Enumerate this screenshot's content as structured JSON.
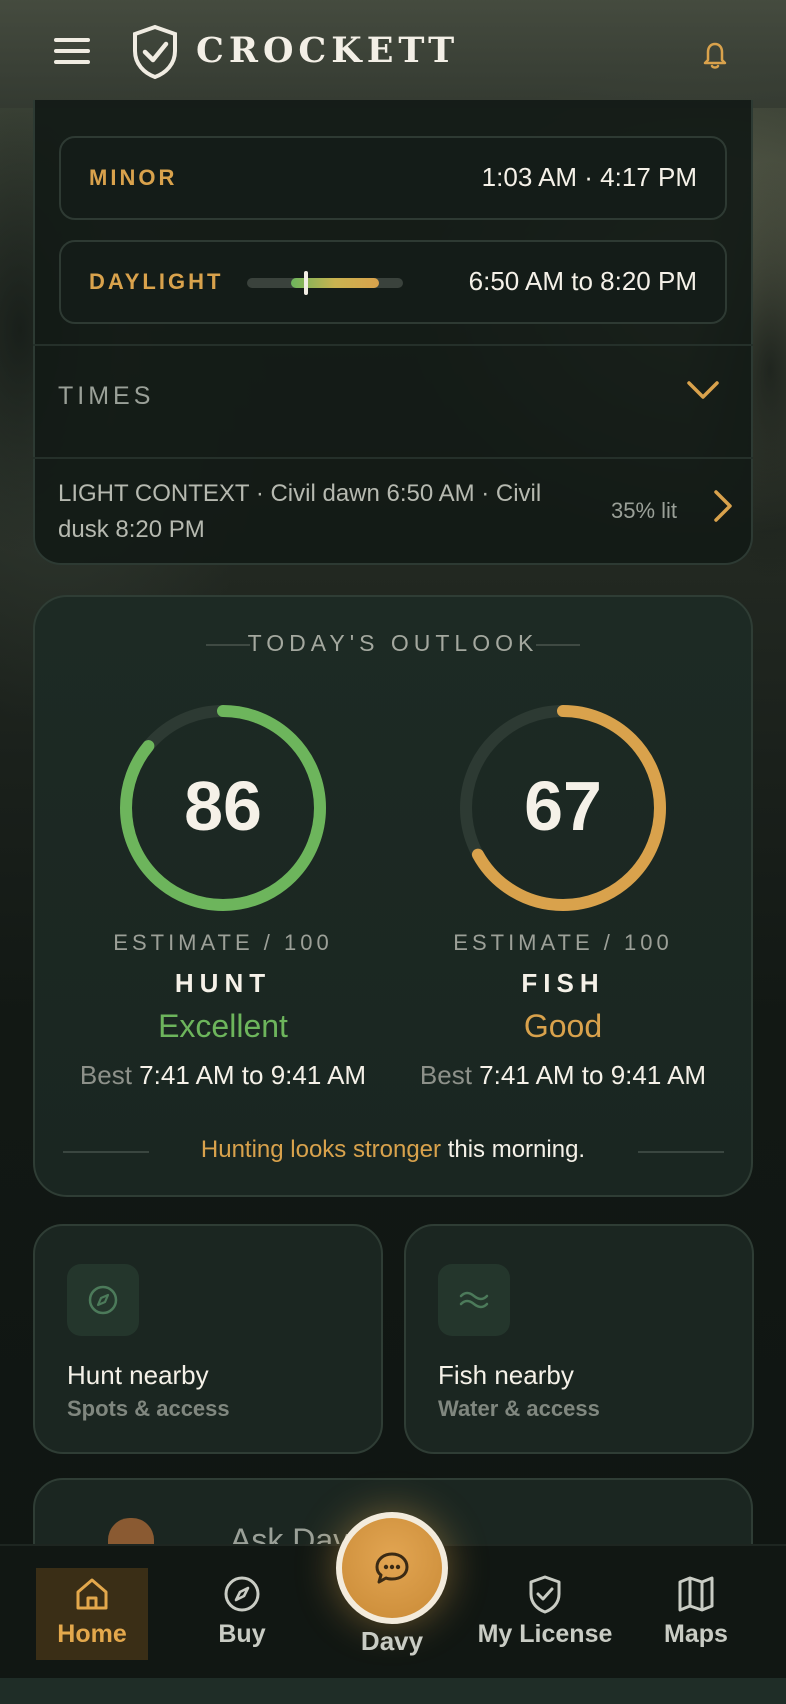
{
  "app": {
    "brand": "CROCKETT"
  },
  "header": {
    "menu_icon": "hamburger-menu-icon",
    "logo_icon": "shield-check-icon",
    "notifications_icon": "bell-icon"
  },
  "times_card": {
    "minor": {
      "label": "MINOR",
      "value": "1:03 AM · 4:17 PM"
    },
    "daylight": {
      "label": "DAYLIGHT",
      "value": "6:50 AM to 8:20 PM",
      "current_progress_fraction": 0.38
    },
    "section_label": "TIMES",
    "light_context": {
      "text": "LIGHT CONTEXT · Civil dawn 6:50 AM · Civil dusk 8:20 PM",
      "moon": "35% lit"
    }
  },
  "outlook": {
    "title": "TODAY'S OUTLOOK",
    "hunt": {
      "score": "86",
      "estimate_label": "ESTIMATE / 100",
      "activity": "HUNT",
      "rating": "Excellent",
      "best_prefix": "Best",
      "best_window": "7:41 AM to 9:41 AM",
      "color": "#6db55c"
    },
    "fish": {
      "score": "67",
      "estimate_label": "ESTIMATE / 100",
      "activity": "FISH",
      "rating": "Good",
      "best_prefix": "Best",
      "best_window": "7:41 AM to 9:41 AM",
      "color": "#d9a24c"
    },
    "summary_highlight": "Hunting looks stronger",
    "summary_rest": " this morning."
  },
  "tiles": {
    "hunt": {
      "title": "Hunt nearby",
      "subtitle": "Spots & access",
      "icon": "compass-icon"
    },
    "fish": {
      "title": "Fish nearby",
      "subtitle": "Water & access",
      "icon": "waves-icon"
    }
  },
  "ask": {
    "text": "Ask Davy"
  },
  "nav": {
    "home": "Home",
    "buy": "Buy",
    "davy": "Davy",
    "license": "My License",
    "maps": "Maps"
  },
  "colors": {
    "accent": "#d9a24c",
    "good": "#6db55c",
    "background": "#0e1512"
  }
}
